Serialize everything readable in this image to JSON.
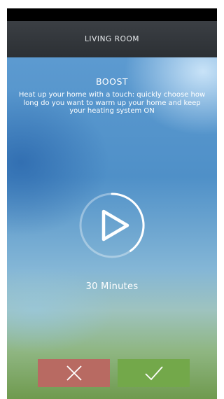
{
  "header": {
    "title": "LIVING ROOM"
  },
  "boost": {
    "title": "BOOST",
    "description": "Heat up your home with a touch: quickly choose how long do you want to warm up your home and keep your heating system ON"
  },
  "dial": {
    "icon": "play-icon",
    "progress_fraction": 0.4
  },
  "duration": {
    "label": "30 Minutes"
  },
  "actions": {
    "cancel_icon": "close-icon",
    "confirm_icon": "check-icon",
    "cancel_color": "#b86a62",
    "confirm_color": "#73a84a"
  }
}
